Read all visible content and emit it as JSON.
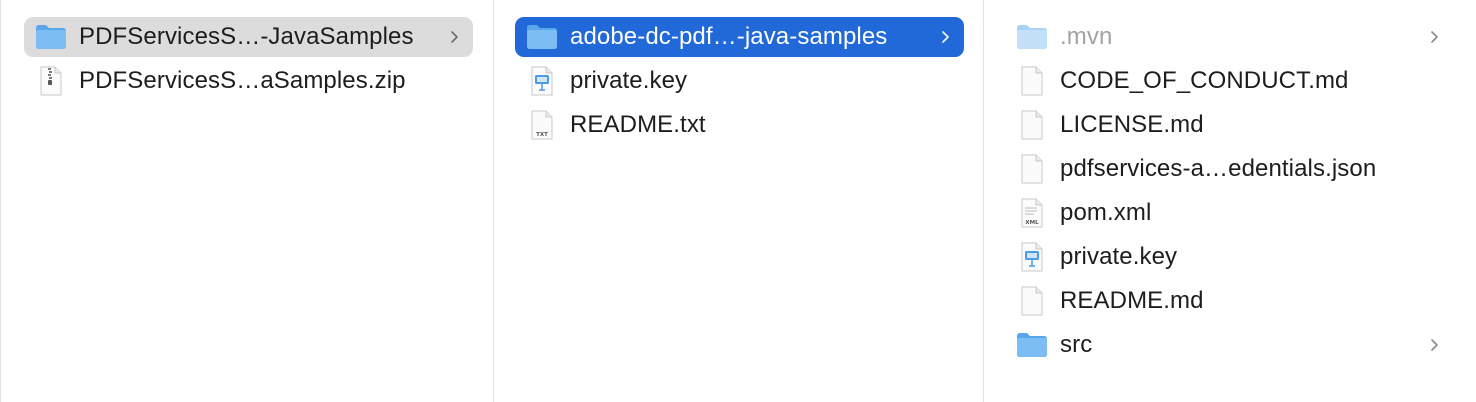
{
  "columns": [
    {
      "items": [
        {
          "name": "PDFServicesS…-JavaSamples",
          "icon": "folder-icon",
          "state": "selected-inactive",
          "has_children": true
        },
        {
          "name": "PDFServicesS…aSamples.zip",
          "icon": "zip-file-icon",
          "state": "normal",
          "has_children": false
        }
      ]
    },
    {
      "items": [
        {
          "name": "adobe-dc-pdf…-java-samples",
          "icon": "folder-icon",
          "state": "selected-active",
          "has_children": true
        },
        {
          "name": "private.key",
          "icon": "keynote-file-icon",
          "state": "normal",
          "has_children": false
        },
        {
          "name": "README.txt",
          "icon": "txt-file-icon",
          "state": "normal",
          "has_children": false,
          "badge": "TXT"
        }
      ]
    },
    {
      "items": [
        {
          "name": ".mvn",
          "icon": "hidden-folder-icon",
          "state": "dimmed",
          "has_children": true
        },
        {
          "name": "CODE_OF_CONDUCT.md",
          "icon": "document-icon",
          "state": "normal",
          "has_children": false
        },
        {
          "name": "LICENSE.md",
          "icon": "document-icon",
          "state": "normal",
          "has_children": false
        },
        {
          "name": "pdfservices-a…edentials.json",
          "icon": "document-icon",
          "state": "normal",
          "has_children": false
        },
        {
          "name": "pom.xml",
          "icon": "xml-file-icon",
          "state": "normal",
          "has_children": false,
          "badge": "XML"
        },
        {
          "name": "private.key",
          "icon": "keynote-file-icon",
          "state": "normal",
          "has_children": false
        },
        {
          "name": "README.md",
          "icon": "document-icon",
          "state": "normal",
          "has_children": false
        },
        {
          "name": "src",
          "icon": "folder-icon",
          "state": "normal",
          "has_children": true
        }
      ]
    }
  ],
  "colors": {
    "selection_active": "#2168d8",
    "selection_inactive": "#dcdcdc",
    "folder": "#6db3ef",
    "dim_text": "#a3a3a3"
  }
}
